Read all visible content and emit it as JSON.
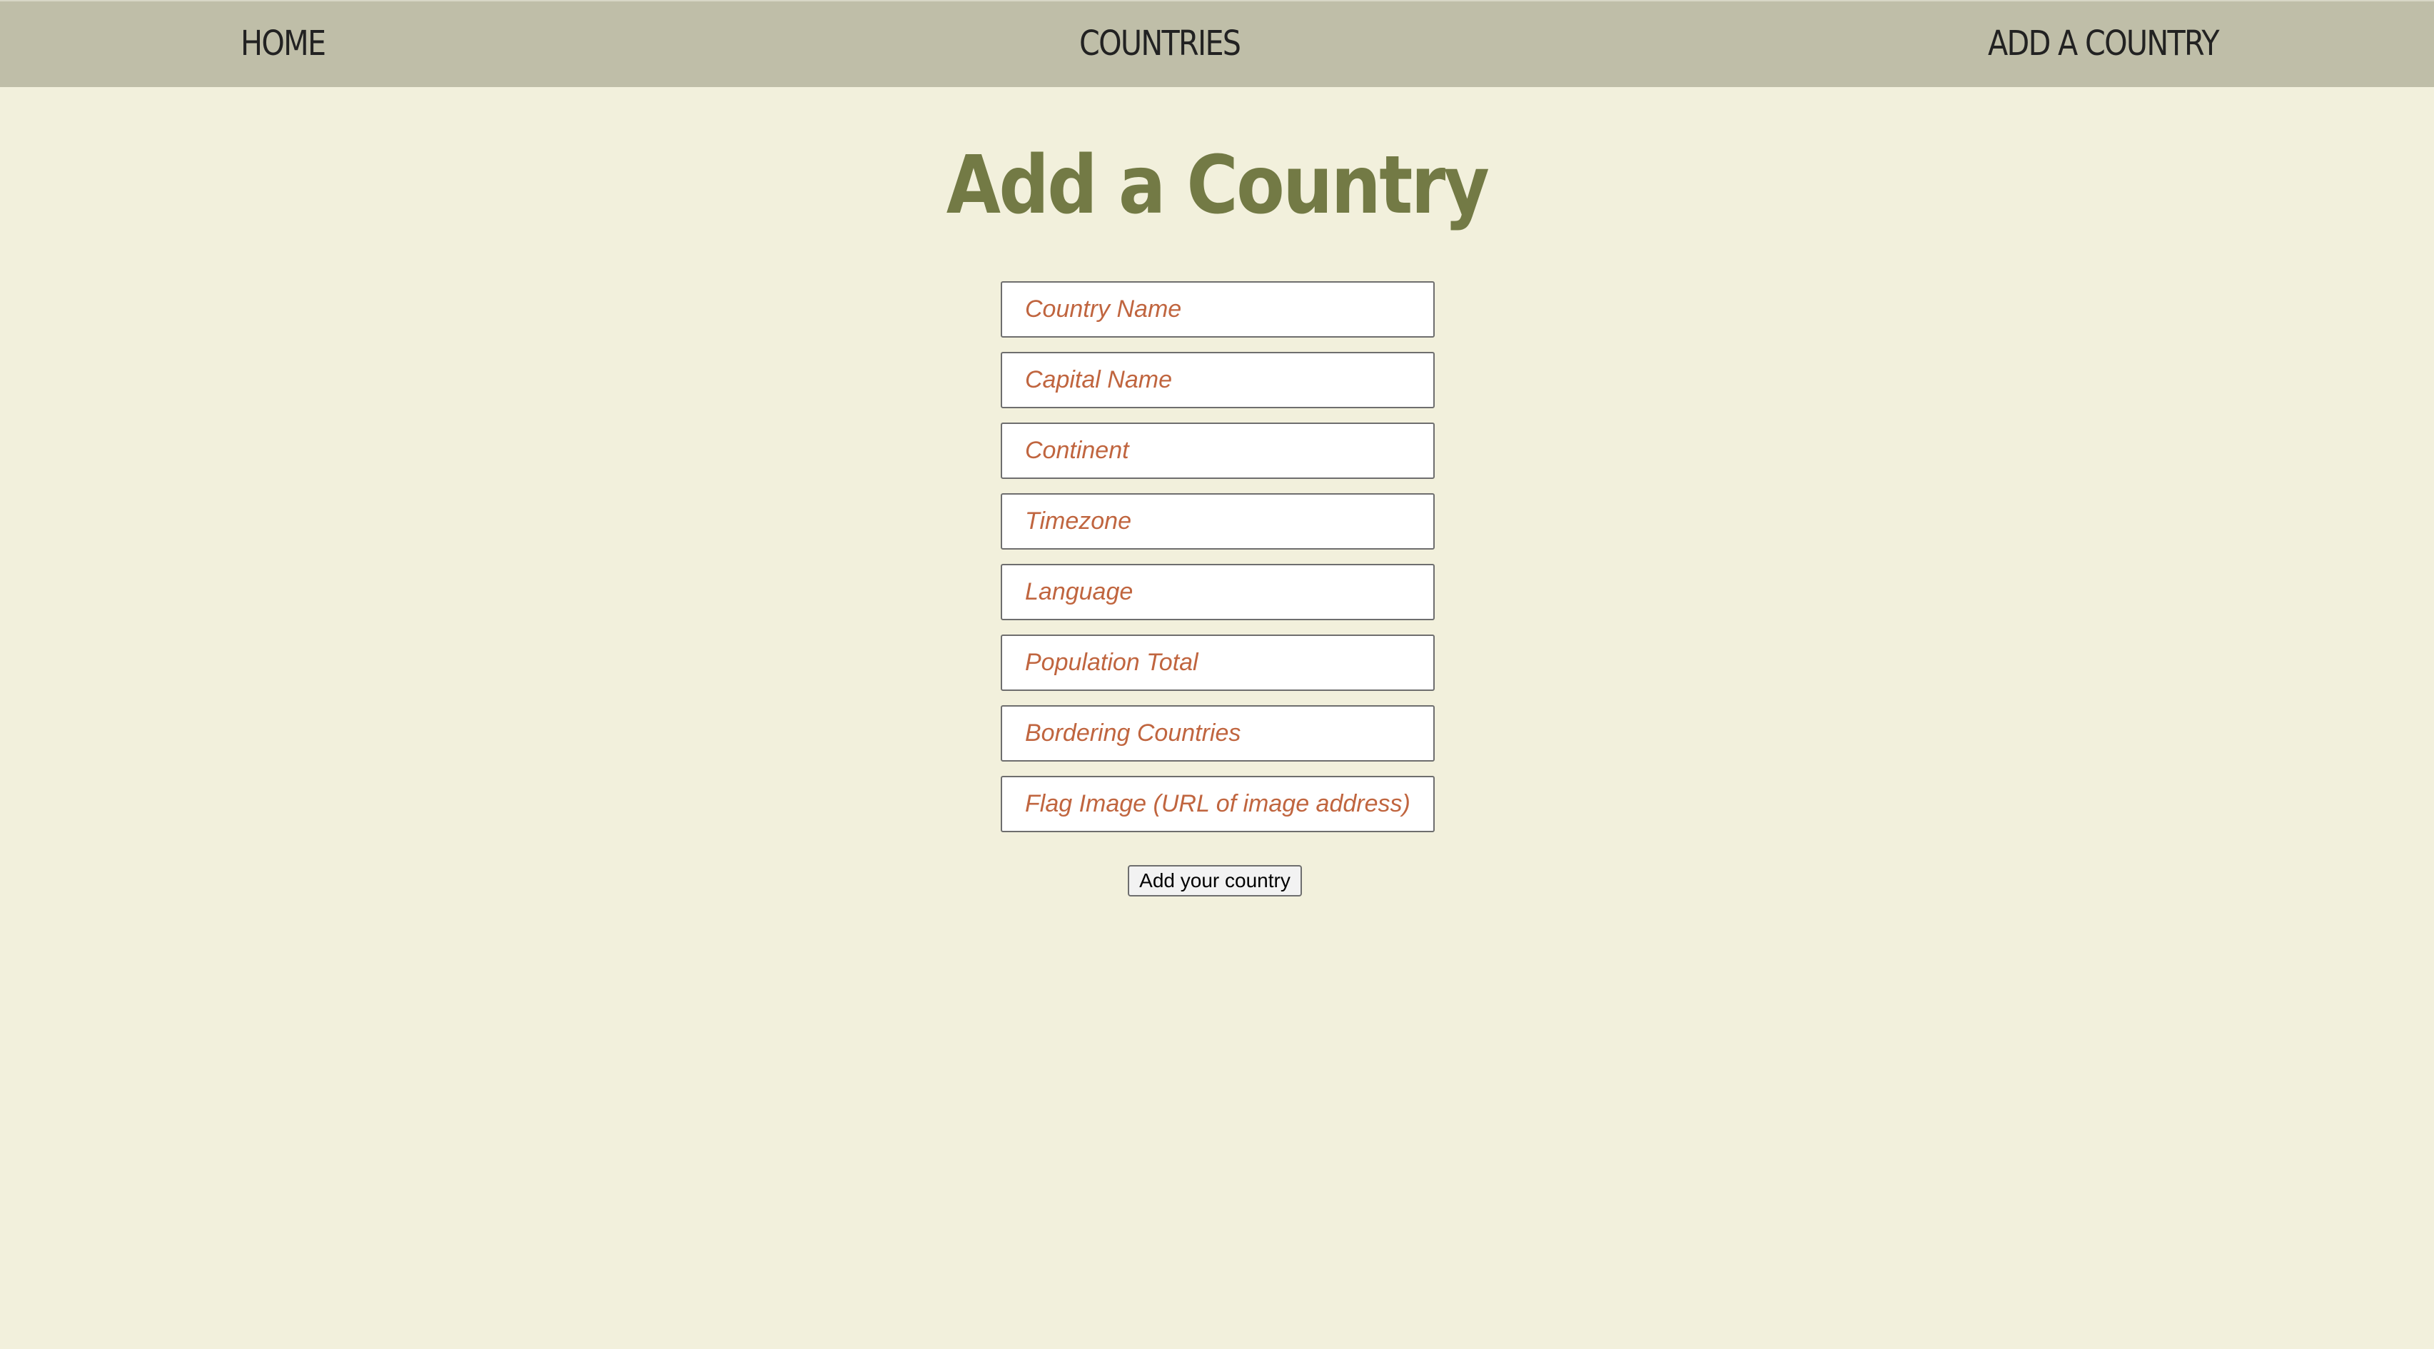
{
  "nav": {
    "home": "HOME",
    "countries": "COUNTRIES",
    "add_country": "ADD A COUNTRY"
  },
  "page": {
    "title": "Add a Country"
  },
  "form": {
    "fields": [
      {
        "placeholder": "Country Name",
        "value": ""
      },
      {
        "placeholder": "Capital Name",
        "value": ""
      },
      {
        "placeholder": "Continent",
        "value": ""
      },
      {
        "placeholder": "Timezone",
        "value": ""
      },
      {
        "placeholder": "Language",
        "value": ""
      },
      {
        "placeholder": "Population Total",
        "value": ""
      },
      {
        "placeholder": "Bordering Countries",
        "value": ""
      },
      {
        "placeholder": "Flag Image (URL of image address)",
        "value": ""
      }
    ],
    "submit_label": "Add your country"
  },
  "colors": {
    "background": "#f2f0dc",
    "navbar": "#bfbea8",
    "title": "#737a45",
    "placeholder": "#c0653f"
  }
}
